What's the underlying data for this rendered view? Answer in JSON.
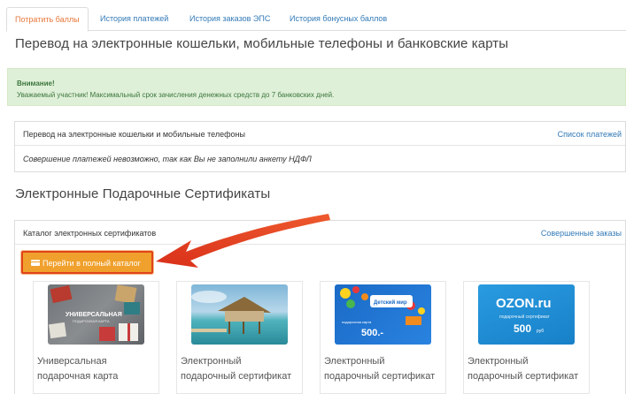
{
  "tabs": [
    {
      "label": "Потратить баллы",
      "active": true
    },
    {
      "label": "История платежей",
      "active": false
    },
    {
      "label": "История заказов ЭПС",
      "active": false
    },
    {
      "label": "История бонусных баллов",
      "active": false
    }
  ],
  "transfer_section": {
    "title": "Перевод на электронные кошельки, мобильные телефоны и банковские карты"
  },
  "alert": {
    "title": "Внимание!",
    "text": "Уважаемый участник! Максимальный срок зачисления денежных средств до 7 банковских дней."
  },
  "transfer_panel": {
    "heading": "Перевод на электронные кошельки и мобильные телефоны",
    "link": "Список платежей",
    "message": "Совершение платежей невозможно, так как Вы не заполнили анкету НДФЛ"
  },
  "certificates_section": {
    "title": "Электронные Подарочные Сертификаты"
  },
  "catalog_panel": {
    "heading": "Каталог электронных сертификатов",
    "link": "Совершенные заказы",
    "button_label": "Перейти в полный каталог"
  },
  "cards": [
    {
      "line1": "Универсальная",
      "line2": "подарочная карта",
      "img_text1": "УНИВЕРСАЛЬНАЯ",
      "img_text2": "ПОДАРОЧНАЯ КАРТА"
    },
    {
      "line1": "Электронный",
      "line2": "подарочный сертификат"
    },
    {
      "line1": "Электронный",
      "line2": "подарочный сертификат",
      "img_brand": "Детский мир",
      "img_card": "подарочная карта",
      "img_value": "500.-"
    },
    {
      "line1": "Электронный",
      "line2": "подарочный сертификат",
      "img_brand": "OZON.ru",
      "img_card": "подарочный сертификат",
      "img_value": "500",
      "img_currency": "руб"
    }
  ],
  "colors": {
    "accent_orange": "#e8773a",
    "link_blue": "#337ab7",
    "alert_bg": "#dff0d8",
    "alert_text": "#3c763d",
    "button_bg": "#f0a02c",
    "arrow_red": "#e23b1b",
    "ozon_blue": "#1b8bd6"
  }
}
